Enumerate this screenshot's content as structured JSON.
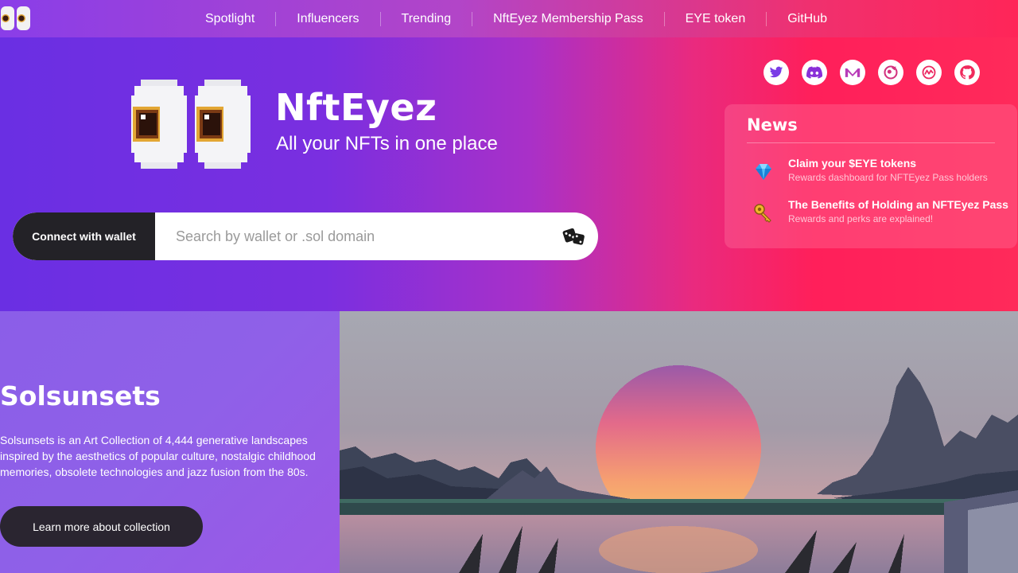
{
  "nav": {
    "logo_icon": "eyes-icon",
    "items": [
      {
        "label": "Spotlight"
      },
      {
        "label": "Influencers"
      },
      {
        "label": "Trending"
      },
      {
        "label": "NftEyez Membership Pass"
      },
      {
        "label": "EYE token"
      },
      {
        "label": "GitHub"
      }
    ]
  },
  "hero": {
    "title": "NftEyez",
    "subtitle": "All your NFTs in one place",
    "connect_label": "Connect with wallet",
    "search_placeholder": "Search by wallet or .sol domain",
    "random_icon": "dice-icon"
  },
  "socials": [
    {
      "icon": "twitter-icon"
    },
    {
      "icon": "discord-icon"
    },
    {
      "icon": "medium-icon"
    },
    {
      "icon": "magic-eden-icon"
    },
    {
      "icon": "coinmarketcap-icon"
    },
    {
      "icon": "github-icon"
    }
  ],
  "news": {
    "title": "News",
    "items": [
      {
        "icon": "diamond-icon",
        "title": "Claim your $EYE tokens",
        "subtitle": "Rewards dashboard for NFTEyez Pass holders"
      },
      {
        "icon": "key-icon",
        "title": "The Benefits of Holding an NFTEyez Pass",
        "subtitle": "Rewards and perks are explained!"
      }
    ]
  },
  "feature": {
    "title": "Solsunsets",
    "description": "Solsunsets is an Art Collection of 4,444 generative landscapes inspired by the aesthetics of popular culture, nostalgic childhood memories, obsolete technologies and jazz fusion from the 80s.",
    "button_label": "Learn more about collection",
    "image_icon": "sunset-landscape-image"
  },
  "colors": {
    "gradient_start": "#6a2fe3",
    "gradient_end": "#ff1f5a",
    "dark_button": "#232227"
  }
}
